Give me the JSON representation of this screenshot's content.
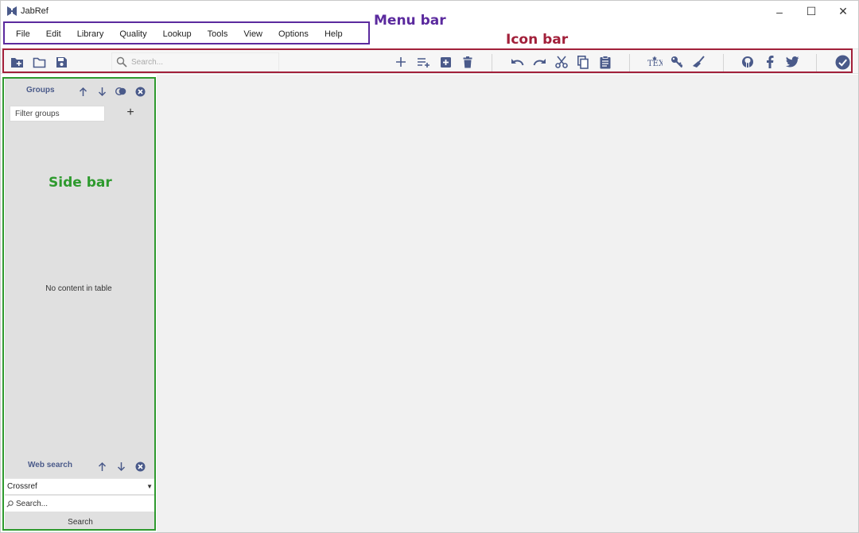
{
  "window": {
    "title": "JabRef",
    "controls": [
      "–",
      "☐",
      "✕"
    ]
  },
  "menu": {
    "items": [
      "File",
      "Edit",
      "Library",
      "Quality",
      "Lookup",
      "Tools",
      "View",
      "Options",
      "Help"
    ]
  },
  "toolbar": {
    "search_placeholder": "Search...",
    "icons": [
      "new-library-icon",
      "open-library-icon",
      "save-library-icon",
      "add-entry-icon",
      "add-entry-list-icon",
      "add-square-icon",
      "delete-icon",
      "undo-icon",
      "redo-icon",
      "cut-icon",
      "copy-icon",
      "paste-icon",
      "tex-icon",
      "key-icon",
      "cleanup-broom-icon",
      "github-icon",
      "facebook-icon",
      "twitter-icon",
      "check-circle-icon"
    ]
  },
  "sidebar": {
    "groups": {
      "title": "Groups",
      "filter_placeholder": "Filter groups",
      "add_label": "+",
      "empty_text": "No content in table"
    },
    "web_search": {
      "title": "Web search",
      "source": "Crossref",
      "search_placeholder": "Search...",
      "button_label": "Search"
    }
  },
  "annotations": {
    "menu_bar": "Menu bar",
    "icon_bar": "Icon bar",
    "side_bar": "Side bar"
  },
  "colors": {
    "icon_primary": "#4a5a8a",
    "menu_annotation": "#5b2a9e",
    "icon_annotation": "#a2203a",
    "side_annotation": "#2e9a2e"
  }
}
